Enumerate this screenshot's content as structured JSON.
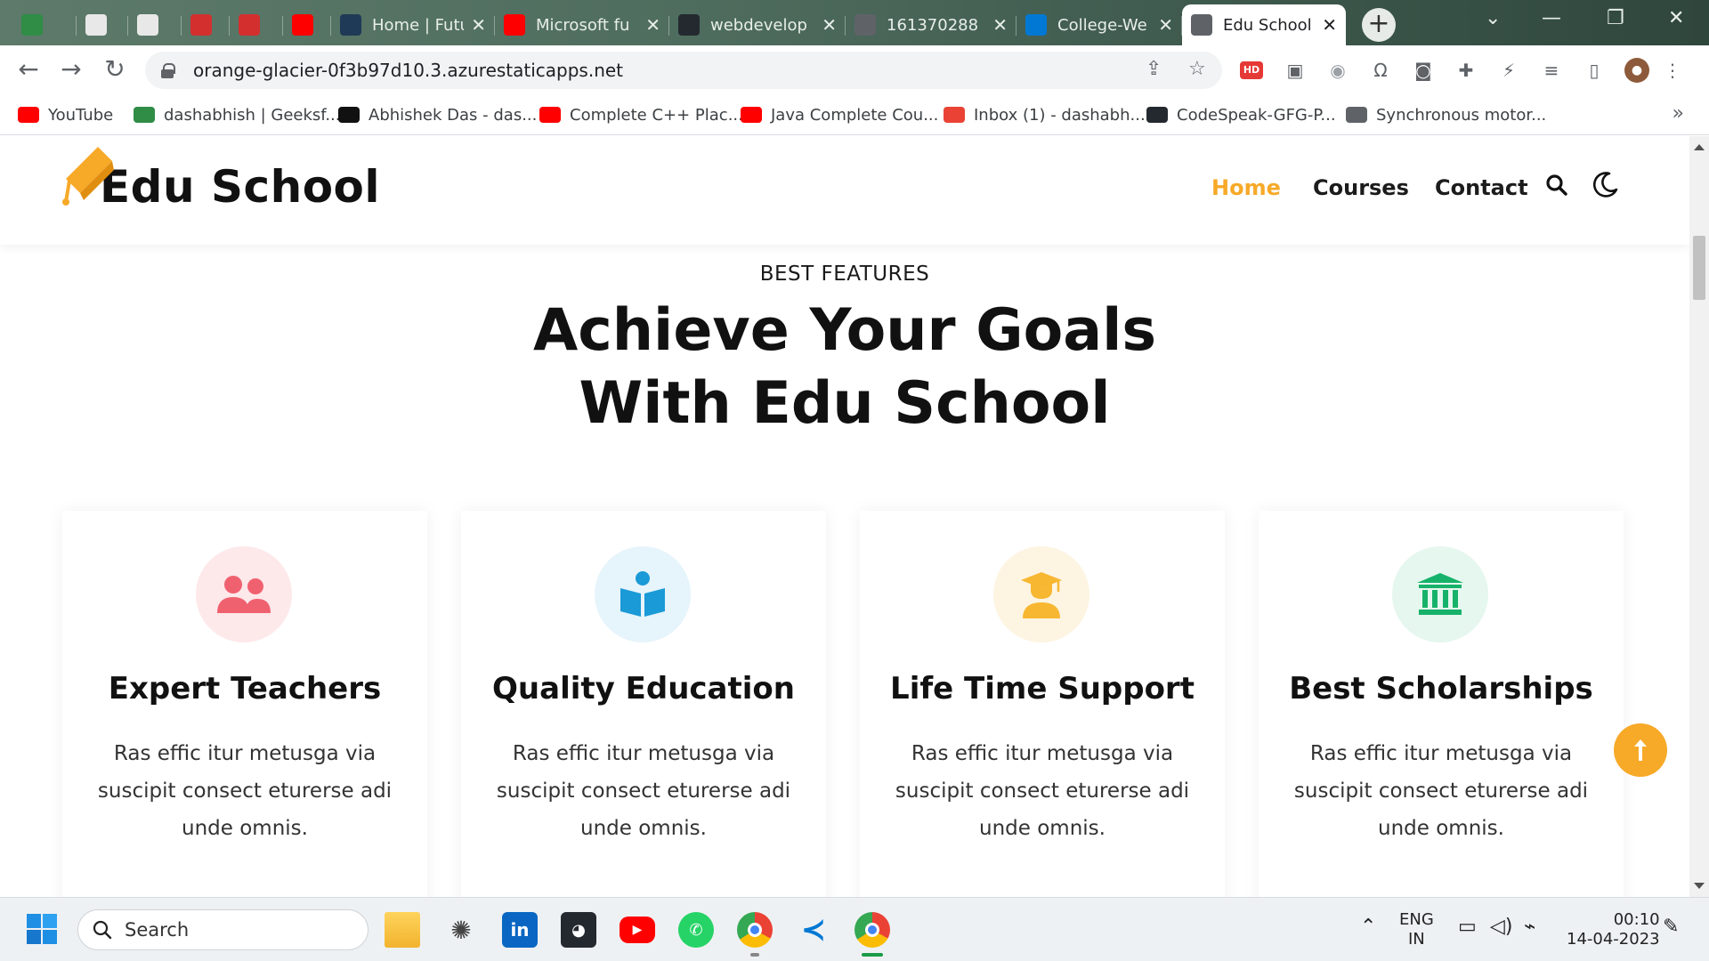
{
  "browser": {
    "tabs": [
      {
        "title": "",
        "favicon": "geeksforgeeks-icon",
        "color": "#2f8d46"
      },
      {
        "title": "",
        "favicon": "edge-site-icon",
        "color": "#e8e8e8"
      },
      {
        "title": "",
        "favicon": "bharat-intern-icon",
        "color": "#e8e8e8"
      },
      {
        "title": "",
        "favicon": "github-red-octo-icon",
        "color": "#d32f2f"
      },
      {
        "title": "",
        "favicon": "github-red-octo-icon",
        "color": "#d32f2f"
      },
      {
        "title": "",
        "favicon": "youtube-icon",
        "color": "#ff0000"
      },
      {
        "title": "Home | Futu",
        "favicon": "futurebox-icon",
        "color": "#1f3a56"
      },
      {
        "title": "Microsoft fu",
        "favicon": "youtube-icon",
        "color": "#ff0000"
      },
      {
        "title": "webdevelop",
        "favicon": "github-icon",
        "color": "#24292f"
      },
      {
        "title": "161370288",
        "favicon": "globe-icon",
        "color": "#5f6368"
      },
      {
        "title": "College-We",
        "favicon": "azure-icon",
        "color": "#0078d4"
      },
      {
        "title": "Edu School",
        "favicon": "globe-icon",
        "color": "#5f6368"
      }
    ],
    "close_glyph": "✕",
    "new_tab_glyph": "+",
    "url": "orange-glacier-0f3b97d10.3.azurestaticapps.net",
    "bookmarks": [
      {
        "label": "YouTube",
        "icon": "youtube-icon",
        "color": "#ff0000"
      },
      {
        "label": "dashabhish | Geeksf...",
        "icon": "geeksforgeeks-icon",
        "color": "#2f8d46"
      },
      {
        "label": "Abhishek Das - das...",
        "icon": "hackerrank-icon",
        "color": "#111"
      },
      {
        "label": "Complete C++ Plac...",
        "icon": "youtube-icon",
        "color": "#ff0000"
      },
      {
        "label": "Java Complete Cou...",
        "icon": "youtube-icon",
        "color": "#ff0000"
      },
      {
        "label": "Inbox (1) - dashabh...",
        "icon": "gmail-icon",
        "color": "#ea4335"
      },
      {
        "label": "CodeSpeak-GFG-P...",
        "icon": "github-icon",
        "color": "#24292f"
      },
      {
        "label": "Synchronous motor...",
        "icon": "globe-icon",
        "color": "#5f6368"
      }
    ],
    "bookmarks_more": "»"
  },
  "site": {
    "brand": "Edu School",
    "accent": "#f7a928",
    "nav": [
      {
        "label": "Home",
        "active": true
      },
      {
        "label": "Courses",
        "active": false
      },
      {
        "label": "Contact",
        "active": false
      }
    ],
    "section": {
      "eyebrow": "BEST FEATURES",
      "headline_line1": "Achieve Your Goals",
      "headline_line2": "With Edu School"
    },
    "features": [
      {
        "title": "Expert Teachers",
        "body": "Ras effic itur metusga via suscipit consect eturerse adi unde omnis.",
        "icon": "users-icon",
        "bg": "#fde8ea",
        "fg": "#f0616f"
      },
      {
        "title": "Quality Education",
        "body": "Ras effic itur metusga via suscipit consect eturerse adi unde omnis.",
        "icon": "book-reader-icon",
        "bg": "#e6f4fb",
        "fg": "#1a9ad6"
      },
      {
        "title": "Life Time Support",
        "body": "Ras effic itur metusga via suscipit consect eturerse adi unde omnis.",
        "icon": "graduate-icon",
        "bg": "#fdf4e2",
        "fg": "#f7b731"
      },
      {
        "title": "Best Scholarships",
        "body": "Ras effic itur metusga via suscipit consect eturerse adi unde omnis.",
        "icon": "institution-icon",
        "bg": "#e5f7ee",
        "fg": "#17b26a"
      }
    ]
  },
  "taskbar": {
    "search_label": "Search",
    "lang_line1": "ENG",
    "lang_line2": "IN",
    "time": "00:10",
    "date": "14-04-2023"
  }
}
